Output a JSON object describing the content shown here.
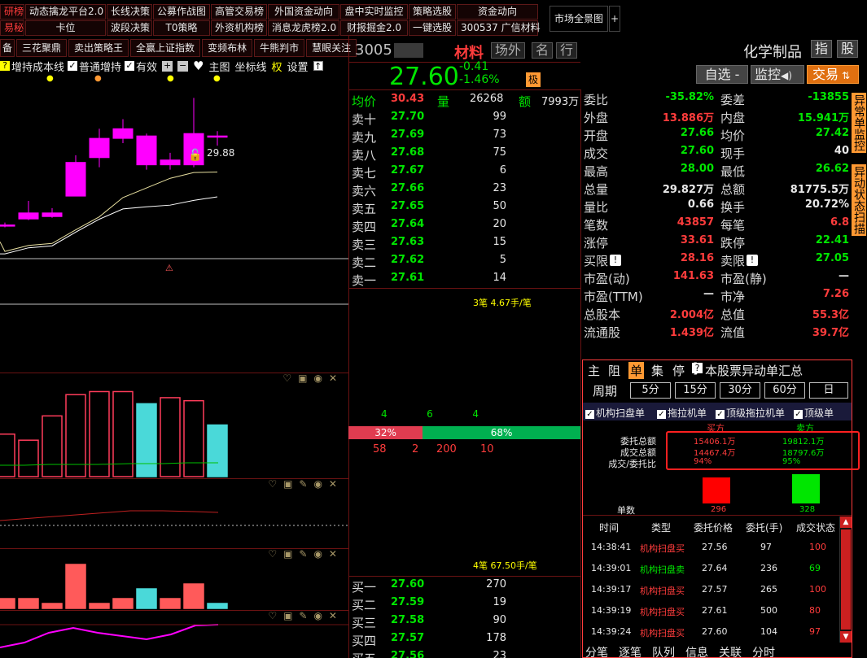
{
  "nav": {
    "row1": [
      "研榜",
      "动态擒龙平台2.0",
      "长线决策",
      "公募作战图",
      "高管交易榜",
      "外国资金动向",
      "盘中实时监控",
      "策略选股",
      "资金动向"
    ],
    "row2": [
      "易秘",
      "卡位",
      "波段决策",
      "T0策略",
      "外资机构榜",
      "消息龙虎榜2.0",
      "财报掘金2.0",
      "一键选股",
      "300537 广信材料"
    ],
    "market_btn": "市场全景图",
    "plus": "+"
  },
  "left": {
    "tabs": [
      "备",
      "三花聚鼎",
      "卖出策略王",
      "全赢上证指数",
      "变频布林",
      "牛熊判市",
      "慧眼关注"
    ],
    "options": {
      "cost_line": "增持成本线",
      "normal": "普通增持",
      "effective": "有效",
      "main_chart": "主图",
      "axis": "坐标线",
      "right": "权",
      "settings": "设置"
    },
    "high_label": "29.88"
  },
  "quote": {
    "code": "3005",
    "name": "材料",
    "btn_field": "场外",
    "btn_name": "名",
    "btn_row": "行",
    "price": "27.60",
    "change": "-0.41",
    "change_pct": "-1.46%",
    "limit_tag": "极",
    "avg_label": "均价",
    "avg_val": "30.43",
    "vol_label": "量",
    "vol_val": "26268",
    "amt_label": "额",
    "amt_val": "7993万",
    "asks": [
      {
        "label": "卖十",
        "price": "27.70",
        "vol": "99"
      },
      {
        "label": "卖九",
        "price": "27.69",
        "vol": "73"
      },
      {
        "label": "卖八",
        "price": "27.68",
        "vol": "75"
      },
      {
        "label": "卖七",
        "price": "27.67",
        "vol": "6"
      },
      {
        "label": "卖六",
        "price": "27.66",
        "vol": "23"
      },
      {
        "label": "卖五",
        "price": "27.65",
        "vol": "50"
      },
      {
        "label": "卖四",
        "price": "27.64",
        "vol": "20"
      },
      {
        "label": "卖三",
        "price": "27.63",
        "vol": "15"
      },
      {
        "label": "卖二",
        "price": "27.62",
        "vol": "5"
      },
      {
        "label": "卖一",
        "price": "27.61",
        "vol": "14"
      }
    ],
    "queue_top": "3笔 4.67手/笔",
    "queue_bottom": "4笔 67.50手/笔",
    "counts_top": [
      "4",
      "6",
      "4"
    ],
    "sell_pct": "32%",
    "buy_pct": "68%",
    "sell_fraction": 0.32,
    "counts_bottom": [
      "58",
      "2",
      "200",
      "10"
    ],
    "bids": [
      {
        "label": "买一",
        "price": "27.60",
        "vol": "270"
      },
      {
        "label": "买二",
        "price": "27.59",
        "vol": "19"
      },
      {
        "label": "买三",
        "price": "27.58",
        "vol": "90"
      },
      {
        "label": "买四",
        "price": "27.57",
        "vol": "178"
      },
      {
        "label": "买五",
        "price": "27.56",
        "vol": "23"
      }
    ]
  },
  "header_right": {
    "sector": "化学制品",
    "btn_index": "指",
    "btn_stock": "股",
    "self_select": "自选 -",
    "monitor": "监控",
    "trade": "交易"
  },
  "stats": [
    {
      "l1": "委比",
      "v1": "-35.82%",
      "c1": "grn",
      "l2": "委差",
      "v2": "-13855",
      "c2": "grn"
    },
    {
      "l1": "外盘",
      "v1": "13.886万",
      "c1": "red",
      "l2": "内盘",
      "v2": "15.941万",
      "c2": "grn"
    },
    {
      "l1": "开盘",
      "v1": "27.66",
      "c1": "grn",
      "l2": "均价",
      "v2": "27.42",
      "c2": "grn"
    },
    {
      "l1": "成交",
      "v1": "27.60",
      "c1": "grn",
      "l2": "现手",
      "v2": "40",
      "c2": "wht"
    },
    {
      "l1": "最高",
      "v1": "28.00",
      "c1": "grn",
      "l2": "最低",
      "v2": "26.62",
      "c2": "grn"
    },
    {
      "l1": "总量",
      "v1": "29.827万",
      "c1": "wht",
      "l2": "总额",
      "v2": "81775.5万",
      "c2": "wht"
    },
    {
      "l1": "量比",
      "v1": "0.66",
      "c1": "wht",
      "l2": "换手",
      "v2": "20.72%",
      "c2": "wht"
    },
    {
      "l1": "笔数",
      "v1": "43857",
      "c1": "red",
      "l2": "每笔",
      "v2": "6.8",
      "c2": "red"
    },
    {
      "l1": "涨停",
      "v1": "33.61",
      "c1": "red",
      "l2": "跌停",
      "v2": "22.41",
      "c2": "grn"
    },
    {
      "l1": "买限",
      "v1": "28.16",
      "c1": "red",
      "l2": "卖限",
      "v2": "27.05",
      "c2": "grn"
    },
    {
      "l1": "市盈(动)",
      "v1": "141.63",
      "c1": "red",
      "l2": "市盈(静)",
      "v2": "—",
      "c2": "wht"
    },
    {
      "l1": "市盈(TTM)",
      "v1": "—",
      "c1": "wht",
      "l2": "市净",
      "v2": "7.26",
      "c2": "red"
    },
    {
      "l1": "总股本",
      "v1": "2.004亿",
      "c1": "red",
      "l2": "总值",
      "v2": "55.3亿",
      "c2": "red"
    },
    {
      "l1": "流通股",
      "v1": "1.439亿",
      "c1": "red",
      "l2": "流值",
      "v2": "39.7亿",
      "c2": "red"
    }
  ],
  "side_tags": [
    "异常单监控",
    "异动状态扫描"
  ],
  "panel": {
    "tabs": [
      "主",
      "阻",
      "单",
      "集",
      "停"
    ],
    "summary_btn": "本股票异动单汇总",
    "period_label": "周期",
    "periods": [
      "5分",
      "15分",
      "30分",
      "60分",
      "日"
    ],
    "filters": [
      "机构扫盘单",
      "拖拉机单",
      "顶级拖拉机单",
      "顶级单"
    ],
    "buy_hdr": "买方",
    "sell_hdr": "卖方",
    "rows": [
      {
        "label": "委托总额",
        "buy": "15406.1万",
        "sell": "19812.1万"
      },
      {
        "label": "成交总额",
        "buy": "14467.4万",
        "sell": "18797.6万"
      },
      {
        "label": "成交/委托比",
        "buy": "94%",
        "sell": "95%"
      }
    ],
    "single_count": "单数",
    "buy_count": "296",
    "sell_count": "328",
    "table_headers": [
      "时间",
      "类型",
      "委托价格",
      "委托(手)",
      "成交状态"
    ],
    "table": [
      {
        "time": "14:38:41",
        "type": "机构扫盘买",
        "price": "27.56",
        "qty": "97",
        "fill": "100"
      },
      {
        "time": "14:39:01",
        "type": "机构扫盘卖",
        "price": "27.64",
        "qty": "236",
        "fill": "69"
      },
      {
        "time": "14:39:17",
        "type": "机构扫盘买",
        "price": "27.57",
        "qty": "265",
        "fill": "100"
      },
      {
        "time": "14:39:19",
        "type": "机构扫盘买",
        "price": "27.61",
        "qty": "500",
        "fill": "80"
      },
      {
        "time": "14:39:24",
        "type": "机构扫盘买",
        "price": "27.60",
        "qty": "104",
        "fill": "97"
      }
    ]
  },
  "bottom_tabs": [
    "分笔",
    "逐笔",
    "队列",
    "信息",
    "关联",
    "分时"
  ],
  "chart_data": [
    {
      "type": "candlestick",
      "title": "",
      "annotations": [
        "29.88"
      ],
      "candles": [
        {
          "open": 24.6,
          "close": 24.6,
          "high": 24.7,
          "low": 24.5
        },
        {
          "open": 24.85,
          "close": 25.1,
          "high": 25.6,
          "low": 24.8
        },
        {
          "open": 24.95,
          "close": 25.1,
          "high": 25.3,
          "low": 24.9
        },
        {
          "open": 25.8,
          "close": 27.2,
          "high": 27.5,
          "low": 25.8
        },
        {
          "open": 27.4,
          "close": 28.2,
          "high": 28.6,
          "low": 27.0
        },
        {
          "open": 28.2,
          "close": 28.6,
          "high": 29.0,
          "low": 28.0
        },
        {
          "open": 28.3,
          "close": 27.1,
          "high": 28.4,
          "low": 26.9
        },
        {
          "open": 27.3,
          "close": 27.1,
          "high": 27.6,
          "low": 26.9
        },
        {
          "open": 27.1,
          "close": 28.4,
          "high": 29.88,
          "low": 27.0
        },
        {
          "open": 28.3,
          "close": 28.3,
          "high": 28.5,
          "low": 27.9
        }
      ],
      "ylim": [
        23.2,
        30.3
      ]
    },
    {
      "type": "bar",
      "title": "",
      "values": [
        14,
        12,
        20,
        27,
        28,
        28,
        24,
        26,
        25,
        17
      ],
      "colors": [
        "#ff3c5a",
        "#ff3c5a",
        "#ff3c5a",
        "#ff3c5a",
        "#ff3c5a",
        "#ff3c5a",
        "#4ad9d9",
        "#ff3c5a",
        "#ff3c5a",
        "#4ad9d9"
      ],
      "ylim": [
        0,
        30
      ]
    },
    {
      "type": "bar",
      "title": "",
      "values": [
        2,
        2,
        1,
        9,
        1,
        2,
        4,
        2,
        5,
        1
      ],
      "colors": [
        "#ff5a5a",
        "#ff5a5a",
        "#ff5a5a",
        "#ff5a5a",
        "#ff5a5a",
        "#ff5a5a",
        "#4ad9d9",
        "#ff5a5a",
        "#ff5a5a",
        "#4ad9d9"
      ],
      "ylim": [
        0,
        10
      ]
    }
  ],
  "colors": {
    "red": "#ff3c3c",
    "green": "#00e600",
    "magenta": "#ff00ff",
    "cyan": "#4ad9d9",
    "orange": "#ff9933"
  }
}
